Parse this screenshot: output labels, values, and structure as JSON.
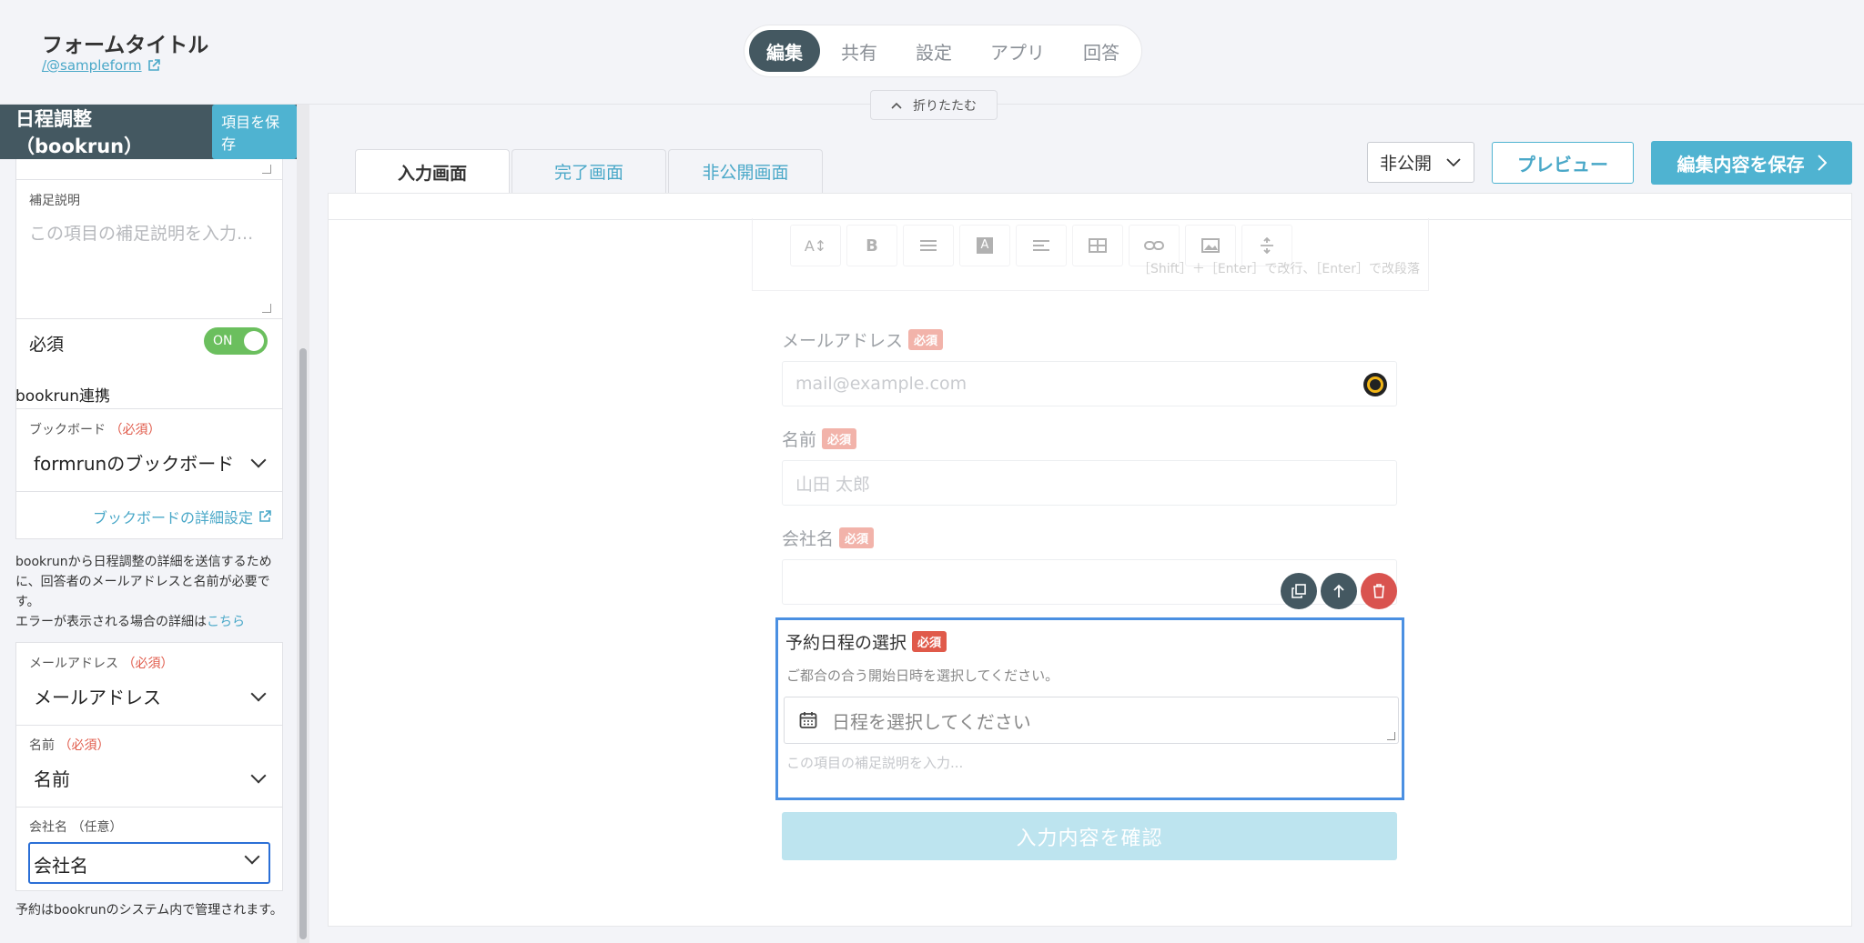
{
  "header": {
    "form_title": "フォームタイトル",
    "form_url": "/@sampleform",
    "tabs": [
      {
        "label": "編集",
        "active": true
      },
      {
        "label": "共有",
        "active": false
      },
      {
        "label": "設定",
        "active": false
      },
      {
        "label": "アプリ",
        "active": false
      },
      {
        "label": "回答",
        "active": false
      }
    ],
    "collapse_label": "折りたたむ"
  },
  "sidebar": {
    "title": "日程調整（bookrun）",
    "save_item_label": "項目を保存",
    "supplement": {
      "label": "補足説明",
      "placeholder": "この項目の補足説明を入力..."
    },
    "required": {
      "label": "必須",
      "toggle": "ON"
    },
    "bookrun_section": "bookrun連携",
    "bookboard": {
      "label": "ブックボード",
      "required_mark": "（必須）",
      "value": "formrunのブックボード",
      "detail_link": "ブックボードの詳細設定"
    },
    "info_text": "bookrunから日程調整の詳細を送信するために、回答者のメールアドレスと名前が必要です。",
    "error_text": "エラーが表示される場合の詳細は",
    "error_link": "こちら",
    "mappings": [
      {
        "label": "メールアドレス",
        "mark": "（必須）",
        "mark_type": "required",
        "value": "メールアドレス"
      },
      {
        "label": "名前",
        "mark": "（必須）",
        "mark_type": "required",
        "value": "名前"
      },
      {
        "label": "会社名",
        "mark": "（任意）",
        "mark_type": "optional",
        "value": "会社名"
      }
    ],
    "footer_text": "予約はbookrunのシステム内で管理されます。"
  },
  "main": {
    "tabs": [
      {
        "label": "入力画面",
        "active": true
      },
      {
        "label": "完了画面",
        "active": false
      },
      {
        "label": "非公開画面",
        "active": false
      }
    ],
    "visibility": "非公開",
    "preview_label": "プレビュー",
    "save_label": "編集内容を保存",
    "toolbar_hint": "［Shift］＋［Enter］で改行、［Enter］で改段落",
    "toolbar_icons": [
      "text-size-icon",
      "bold-icon",
      "list-icon",
      "text-color-icon",
      "align-icon",
      "table-icon",
      "link-icon",
      "image-icon",
      "divider-icon"
    ],
    "fields": [
      {
        "label": "メールアドレス",
        "badge": "必須",
        "placeholder": "mail@example.com"
      },
      {
        "label": "名前",
        "badge": "必須",
        "placeholder": "山田 太郎"
      },
      {
        "label": "会社名",
        "badge": "必須",
        "placeholder": ""
      }
    ],
    "active_field": {
      "label": "予約日程の選択",
      "badge": "必須",
      "description": "ご都合の合う開始日時を選択してください。",
      "date_placeholder": "日程を選択してください",
      "hint": "この項目の補足説明を入力..."
    },
    "confirm_label": "入力内容を確認"
  },
  "colors": {
    "accent": "#4fb3d1",
    "dark": "#445861",
    "required": "#e05a4a",
    "toggle_on": "#6bbf5e",
    "focus": "#4b90e2"
  }
}
